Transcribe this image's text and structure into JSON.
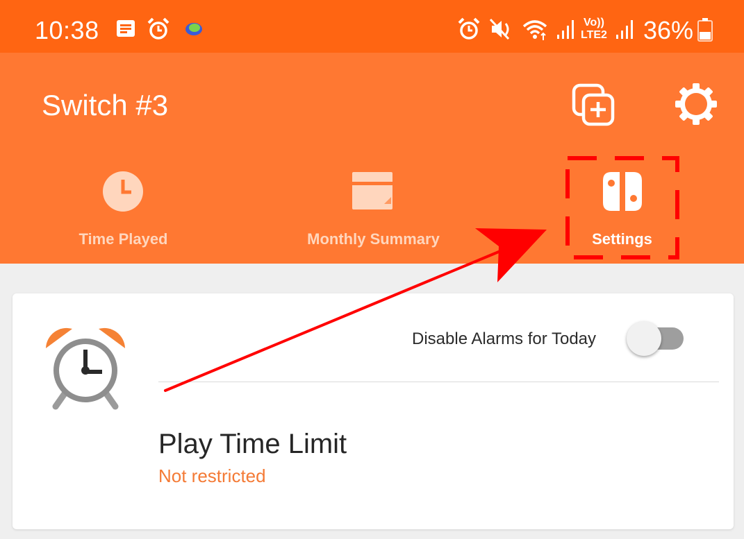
{
  "status_bar": {
    "time": "10:38",
    "battery_percent": "36%",
    "network_label_top": "Vo))",
    "network_label_bottom": "LTE2",
    "icons": [
      "notes-icon",
      "alarm-icon",
      "app-icon",
      "alarm-icon",
      "mute-icon",
      "wifi-icon",
      "signal-icon",
      "signal-icon",
      "battery-icon"
    ]
  },
  "header": {
    "title": "Switch #3",
    "actions": [
      "add-console-icon",
      "gear-icon"
    ]
  },
  "tabs": [
    {
      "label": "Time Played",
      "icon": "clock-icon",
      "active": false
    },
    {
      "label": "Monthly Summary",
      "icon": "calendar-icon",
      "active": false
    },
    {
      "label": "Settings",
      "icon": "switch-console-icon",
      "active": true
    }
  ],
  "card": {
    "toggle_label": "Disable Alarms for Today",
    "toggle_on": false,
    "limit_title": "Play Time Limit",
    "limit_value": "Not restricted",
    "icon": "alarm-clock-icon"
  },
  "colors": {
    "status_bar": "#ff6512",
    "app_bar": "#ff7832",
    "accent_text": "#f47a35",
    "annotation": "#ff0000",
    "background": "#efefef"
  },
  "annotation": {
    "type": "arrow-and-dashed-box",
    "target": "Settings"
  }
}
